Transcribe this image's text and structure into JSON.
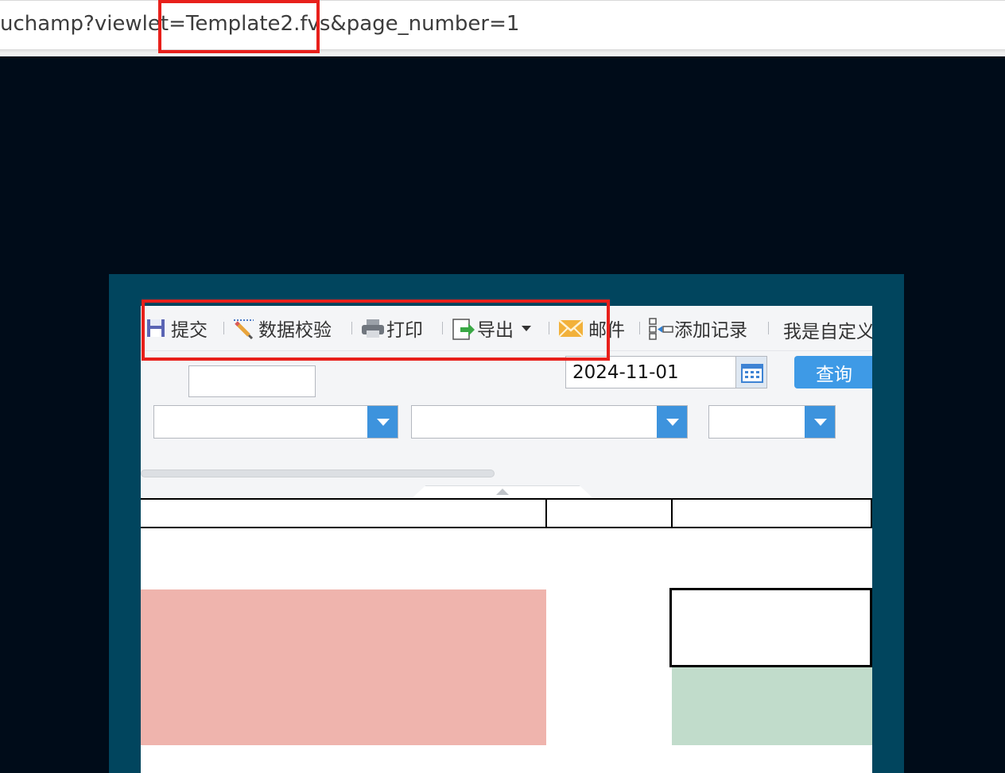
{
  "address_bar": {
    "url": "uchamp?viewlet=Template2.fvs&page_number=1"
  },
  "toolbar": {
    "items": [
      {
        "label": "提交",
        "icon": "save-icon"
      },
      {
        "label": "数据校验",
        "icon": "pencil-icon"
      },
      {
        "label": "打印",
        "icon": "printer-icon"
      },
      {
        "label": "导出",
        "icon": "export-icon"
      },
      {
        "label": "邮件",
        "icon": "mail-icon"
      },
      {
        "label": "添加记录",
        "icon": "add-record-icon"
      },
      {
        "label": "我是自定义",
        "icon": ""
      }
    ]
  },
  "params": {
    "text_input_value": "",
    "date_value": "2024-11-01",
    "query_label": "查询",
    "combo_1_value": "",
    "combo_2_value": "",
    "combo_3_value": ""
  },
  "colors": {
    "annotation": "#e8201b",
    "frame": "#01455e",
    "background": "#000c19",
    "query_button": "#3e9ae6",
    "cell_red": "#efb4ad",
    "cell_green": "#c1dccb"
  }
}
